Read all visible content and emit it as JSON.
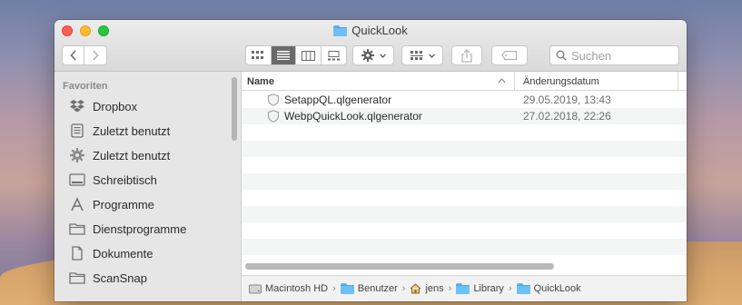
{
  "window": {
    "title": "QuickLook"
  },
  "toolbar": {
    "search_placeholder": "Suchen",
    "view_modes": [
      "icon-view",
      "list-view",
      "column-view",
      "gallery-view"
    ],
    "active_view": "list-view"
  },
  "sidebar": {
    "heading": "Favoriten",
    "items": [
      {
        "label": "Dropbox",
        "icon": "dropbox-icon"
      },
      {
        "label": "Zuletzt benutzt",
        "icon": "recents-icon"
      },
      {
        "label": "Zuletzt benutzt",
        "icon": "gear-icon"
      },
      {
        "label": "Schreibtisch",
        "icon": "desktop-icon"
      },
      {
        "label": "Programme",
        "icon": "applications-icon"
      },
      {
        "label": "Dienstprogramme",
        "icon": "folder-icon"
      },
      {
        "label": "Dokumente",
        "icon": "document-icon"
      },
      {
        "label": "ScanSnap",
        "icon": "folder-icon"
      }
    ]
  },
  "list": {
    "columns": {
      "name": "Name",
      "date": "Änderungsdatum"
    },
    "rows": [
      {
        "name": "SetappQL.qlgenerator",
        "date": "29.05.2019, 13:43"
      },
      {
        "name": "WebpQuickLook.qlgenerator",
        "date": "27.02.2018, 22:26"
      }
    ]
  },
  "pathbar": [
    {
      "label": "Macintosh HD",
      "icon": "hard-drive-icon"
    },
    {
      "label": "Benutzer",
      "icon": "folder-icon"
    },
    {
      "label": "jens",
      "icon": "home-icon"
    },
    {
      "label": "Library",
      "icon": "folder-icon"
    },
    {
      "label": "QuickLook",
      "icon": "folder-icon"
    }
  ],
  "colors": {
    "close": "#fe5f57",
    "minimize": "#febc2e",
    "maximize": "#28c840",
    "folder": "#6cc0f3"
  }
}
